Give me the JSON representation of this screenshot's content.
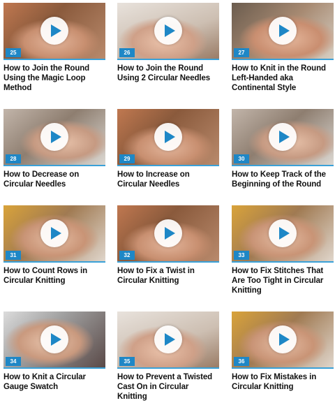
{
  "videos": [
    {
      "number": "25",
      "title": "How to Join the Round Using the Magic Loop Method"
    },
    {
      "number": "26",
      "title": "How to Join the Round Using 2 Circular Needles"
    },
    {
      "number": "27",
      "title": "How to Knit in the Round Left-Handed aka Continental Style"
    },
    {
      "number": "28",
      "title": "How to Decrease on Circular Needles"
    },
    {
      "number": "29",
      "title": "How to Increase on Circular Needles"
    },
    {
      "number": "30",
      "title": "How to Keep Track of the Beginning of the Round"
    },
    {
      "number": "31",
      "title": "How to Count Rows in Circular Knitting"
    },
    {
      "number": "32",
      "title": "How to Fix a Twist in Circular Knitting"
    },
    {
      "number": "33",
      "title": "How to Fix Stitches That Are Too Tight in Circular Knitting"
    },
    {
      "number": "34",
      "title": "How to Knit a Circular Gauge Swatch"
    },
    {
      "number": "35",
      "title": "How to Prevent a Twisted Cast On in Circular Knitting"
    },
    {
      "number": "36",
      "title": "How to Fix Mistakes in Circular Knitting"
    }
  ],
  "colors": {
    "accent": "#1e87c6",
    "underline": "#3aa1d8",
    "title_text": "#111111"
  },
  "icons": {
    "play": "play-icon"
  }
}
